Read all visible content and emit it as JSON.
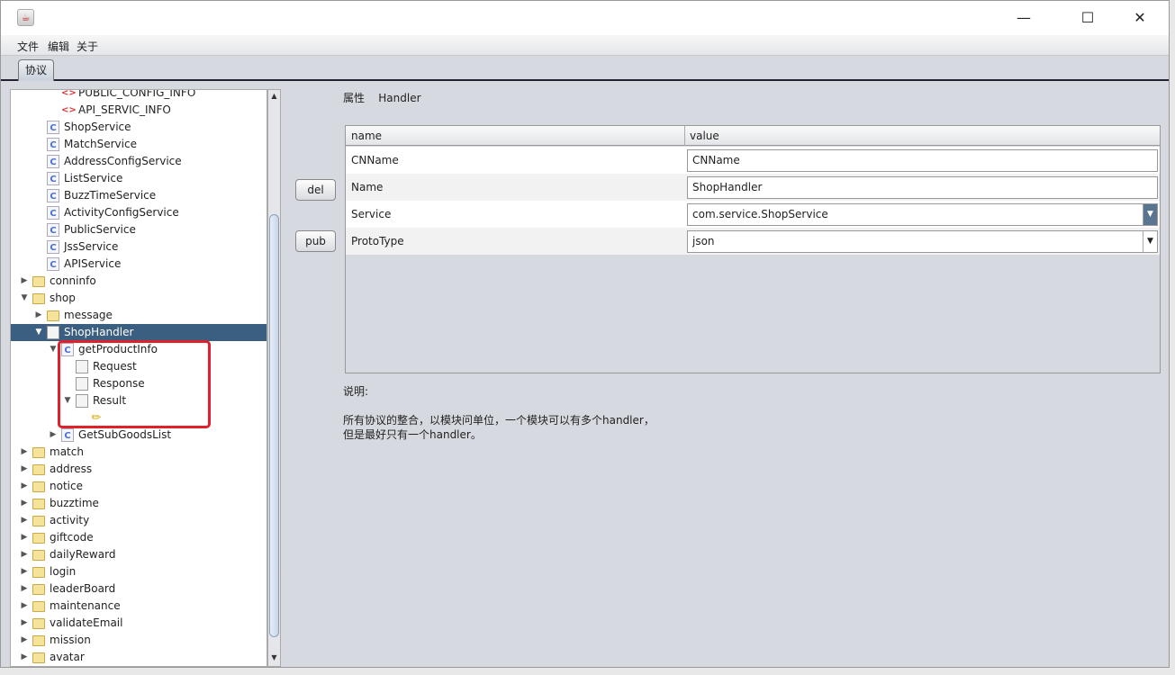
{
  "window": {
    "icon": "java-icon",
    "controls": [
      "minimize",
      "maximize",
      "close"
    ]
  },
  "menu": [
    "文件",
    "编辑",
    "关于"
  ],
  "tab": "协议",
  "tree": [
    {
      "label": "PUBLIC_CONFIG_INFO",
      "level": 3,
      "icon": "xml",
      "toggle": ""
    },
    {
      "label": "API_SERVIC_INFO",
      "level": 3,
      "icon": "xml",
      "toggle": ""
    },
    {
      "label": "ShopService",
      "level": 2,
      "icon": "cls",
      "toggle": ""
    },
    {
      "label": "MatchService",
      "level": 2,
      "icon": "cls",
      "toggle": ""
    },
    {
      "label": "AddressConfigService",
      "level": 2,
      "icon": "cls",
      "toggle": ""
    },
    {
      "label": "ListService",
      "level": 2,
      "icon": "cls",
      "toggle": ""
    },
    {
      "label": "BuzzTimeService",
      "level": 2,
      "icon": "cls",
      "toggle": ""
    },
    {
      "label": "ActivityConfigService",
      "level": 2,
      "icon": "cls",
      "toggle": ""
    },
    {
      "label": "PublicService",
      "level": 2,
      "icon": "cls",
      "toggle": ""
    },
    {
      "label": "JssService",
      "level": 2,
      "icon": "cls",
      "toggle": ""
    },
    {
      "label": "APIService",
      "level": 2,
      "icon": "cls",
      "toggle": ""
    },
    {
      "label": "conninfo",
      "level": 1,
      "icon": "folder",
      "toggle": "collapsed"
    },
    {
      "label": "shop",
      "level": 1,
      "icon": "folder",
      "toggle": "expanded"
    },
    {
      "label": "message",
      "level": 2,
      "icon": "folder",
      "toggle": "collapsed"
    },
    {
      "label": "ShopHandler",
      "level": 2,
      "icon": "file",
      "toggle": "expanded",
      "selected": true
    },
    {
      "label": "getProductInfo",
      "level": 3,
      "icon": "cls",
      "toggle": "expanded"
    },
    {
      "label": "Request",
      "level": 4,
      "icon": "file",
      "toggle": ""
    },
    {
      "label": "Response",
      "level": 4,
      "icon": "file",
      "toggle": ""
    },
    {
      "label": "Result",
      "level": 4,
      "icon": "file",
      "toggle": "expanded"
    },
    {
      "label": "",
      "level": 5,
      "icon": "pencil",
      "toggle": ""
    },
    {
      "label": "GetSubGoodsList",
      "level": 3,
      "icon": "cls",
      "toggle": "collapsed"
    },
    {
      "label": "match",
      "level": 1,
      "icon": "folder",
      "toggle": "collapsed"
    },
    {
      "label": "address",
      "level": 1,
      "icon": "folder",
      "toggle": "collapsed"
    },
    {
      "label": "notice",
      "level": 1,
      "icon": "folder",
      "toggle": "collapsed"
    },
    {
      "label": "buzztime",
      "level": 1,
      "icon": "folder",
      "toggle": "collapsed"
    },
    {
      "label": "activity",
      "level": 1,
      "icon": "folder",
      "toggle": "collapsed"
    },
    {
      "label": "giftcode",
      "level": 1,
      "icon": "folder",
      "toggle": "collapsed"
    },
    {
      "label": "dailyReward",
      "level": 1,
      "icon": "folder",
      "toggle": "collapsed"
    },
    {
      "label": "login",
      "level": 1,
      "icon": "folder",
      "toggle": "collapsed"
    },
    {
      "label": "leaderBoard",
      "level": 1,
      "icon": "folder",
      "toggle": "collapsed"
    },
    {
      "label": "maintenance",
      "level": 1,
      "icon": "folder",
      "toggle": "collapsed"
    },
    {
      "label": "validateEmail",
      "level": 1,
      "icon": "folder",
      "toggle": "collapsed"
    },
    {
      "label": "mission",
      "level": 1,
      "icon": "folder",
      "toggle": "collapsed"
    },
    {
      "label": "avatar",
      "level": 1,
      "icon": "folder",
      "toggle": "collapsed"
    }
  ],
  "buttons": {
    "del": "del",
    "pub": "pub"
  },
  "props": {
    "label": "属性",
    "type": "Handler"
  },
  "table": {
    "headers": [
      "name",
      "value"
    ],
    "rows": [
      {
        "name": "CNName",
        "value": "CNName",
        "kind": "text"
      },
      {
        "name": "Name",
        "value": "ShopHandler",
        "kind": "text"
      },
      {
        "name": "Service",
        "value": "com.service.ShopService",
        "kind": "combo"
      },
      {
        "name": "ProtoType",
        "value": "json",
        "kind": "combo"
      }
    ]
  },
  "description": {
    "label": "说明:",
    "lines": [
      "所有协议的整合，以模块问单位，一个模块可以有多个handler，",
      "但是最好只有一个handler。"
    ]
  },
  "highlight_color": "#e0202a",
  "selection_color": "#3a5f80"
}
